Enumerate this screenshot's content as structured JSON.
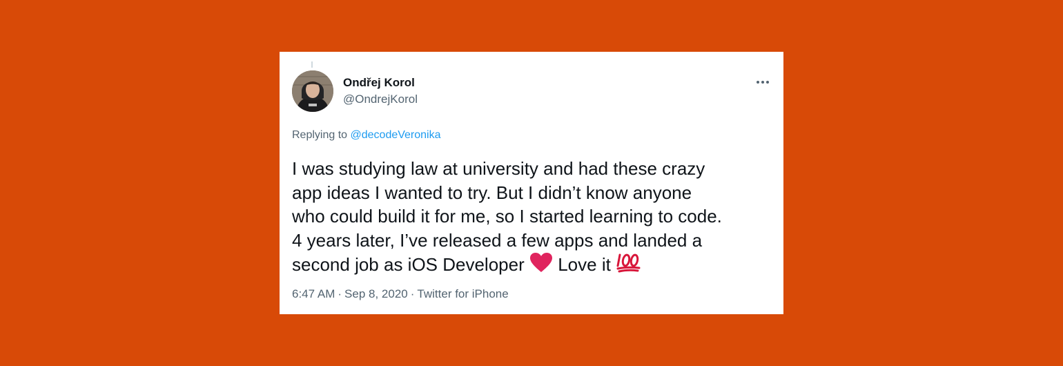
{
  "tweet": {
    "author": {
      "display_name": "Ondřej Korol",
      "handle": "@OndrejKorol"
    },
    "reply": {
      "prefix": "Replying to",
      "mention": "@decodeVeronika"
    },
    "text": {
      "line1": "I was studying law at university and had these crazy",
      "line2": "app ideas I wanted to try. But I didn’t know anyone",
      "line3": "who could build it for me, so I started learning to code.",
      "line4": "4 years later, I’ve released a few apps and landed a",
      "line5_before": "second job as iOS Developer",
      "line5_after": "Love it",
      "emoji_1": "red-heart",
      "emoji_2": "hundred-points"
    },
    "meta": {
      "time": "6:47 AM",
      "separator": "·",
      "date": "Sep 8, 2020",
      "source": "Twitter for iPhone"
    }
  },
  "colors": {
    "background": "#d84a07",
    "card": "#ffffff",
    "text_primary": "#0f1419",
    "text_secondary": "#536471",
    "link": "#1d9bf0",
    "heart": "#e0245e",
    "hundred": "#d8163a"
  }
}
